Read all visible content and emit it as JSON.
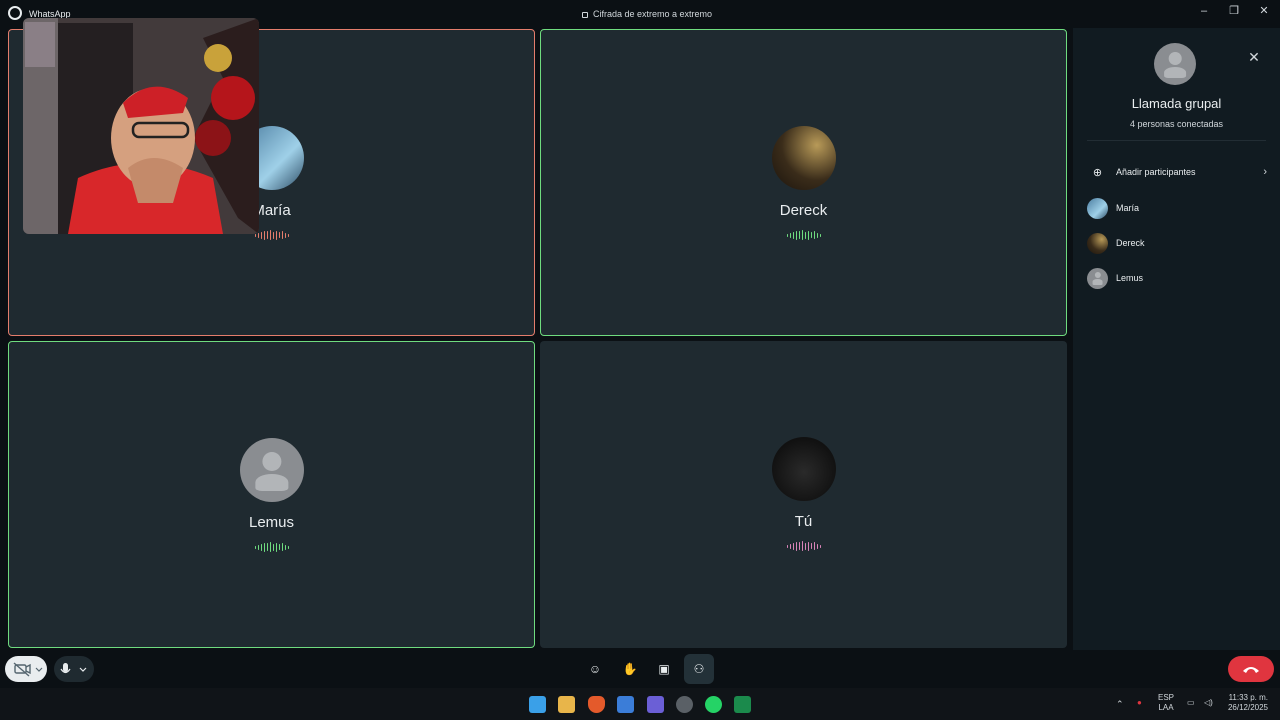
{
  "app": {
    "title": "WhatsApp",
    "encryption_notice": "Cifrada de extremo a extremo"
  },
  "participants_grid": [
    {
      "name": "María",
      "border": "red",
      "speaking_color": "#e47d6c"
    },
    {
      "name": "Dereck",
      "border": "green",
      "speaking_color": "#6fdc7f"
    },
    {
      "name": "Lemus",
      "border": "green",
      "speaking_color": "#6fdc7f"
    },
    {
      "name": "Tú",
      "border": "none",
      "speaking_color": "#d883b7"
    }
  ],
  "panel": {
    "title": "Llamada grupal",
    "subtitle": "4 personas conectadas",
    "add_label": "Añadir participantes",
    "members": [
      "María",
      "Dereck",
      "Lemus"
    ]
  },
  "controls": {
    "icons": [
      "camera-off-icon",
      "microphone-icon",
      "emoji-icon",
      "raise-hand-icon",
      "share-screen-icon",
      "participants-icon",
      "end-call-icon"
    ]
  },
  "taskbar": {
    "language": "ESP",
    "layout": "LAA",
    "time": "11:33 p. m.",
    "date": "26/12/2025"
  },
  "colors": {
    "accent_green": "#6fdc7f",
    "accent_red": "#e47d6c",
    "end_call": "#e0353f",
    "tile_bg": "#1f2a30"
  }
}
